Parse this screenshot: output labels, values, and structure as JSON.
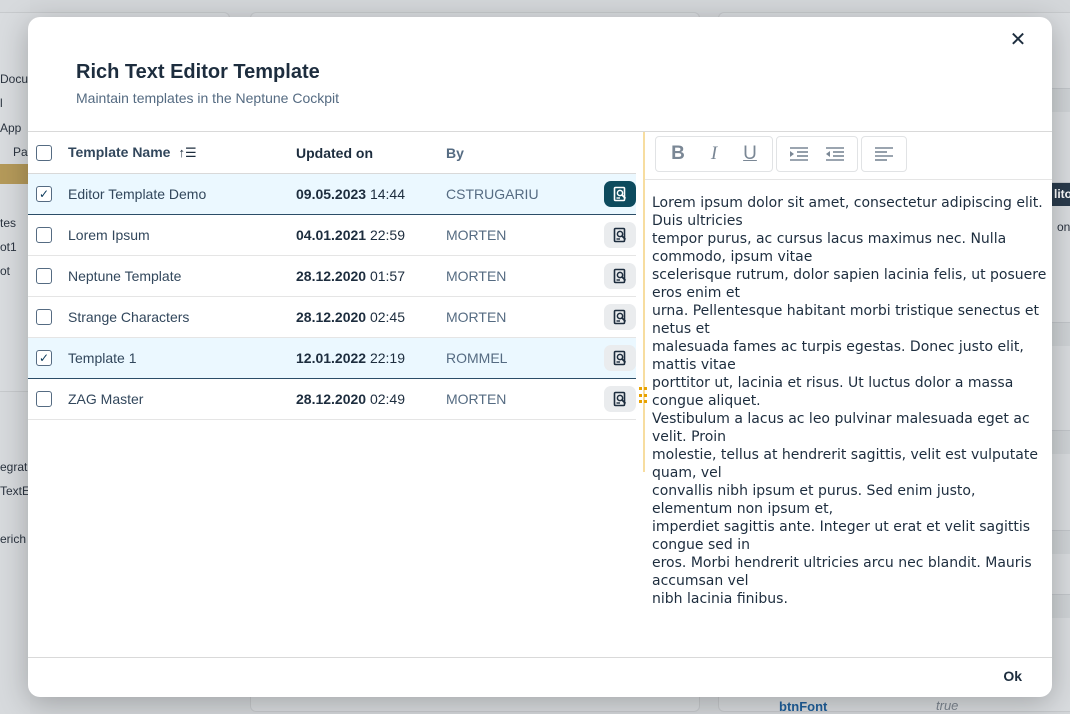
{
  "background": {
    "left_labels": [
      "Docu",
      "l",
      "App",
      "Pa",
      "tes",
      "ot1",
      "ot",
      "egrati",
      "TextE",
      "erich"
    ],
    "bottom_link": "btnFont",
    "bottom_value": "true",
    "right_label_1": "lito",
    "right_label_2": "on"
  },
  "dialog": {
    "title": "Rich Text Editor Template",
    "subtitle": "Maintain templates in the Neptune Cockpit",
    "close_icon": "close-icon",
    "ok_label": "Ok"
  },
  "table": {
    "columns": {
      "name": "Template Name",
      "updated": "Updated on",
      "by": "By"
    },
    "rows": [
      {
        "name": "Editor Template Demo",
        "date": "09.05.2023",
        "time": "14:44",
        "by": "CSTRUGARIU",
        "checked": true
      },
      {
        "name": "Lorem Ipsum",
        "date": "04.01.2021",
        "time": "22:59",
        "by": "MORTEN",
        "checked": false
      },
      {
        "name": "Neptune Template",
        "date": "28.12.2020",
        "time": "01:57",
        "by": "MORTEN",
        "checked": false
      },
      {
        "name": "Strange Characters",
        "date": "28.12.2020",
        "time": "02:45",
        "by": "MORTEN",
        "checked": false
      },
      {
        "name": "Template 1",
        "date": "12.01.2022",
        "time": "22:19",
        "by": "ROMMEL",
        "checked": true
      },
      {
        "name": "ZAG Master",
        "date": "28.12.2020",
        "time": "02:49",
        "by": "MORTEN",
        "checked": false
      }
    ]
  },
  "editor": {
    "toolbar_icons": [
      "bold-icon",
      "italic-icon",
      "underline-icon",
      "indent-icon",
      "outdent-icon",
      "align-left-icon"
    ],
    "lines": [
      "Lorem ipsum dolor sit amet, consectetur adipiscing elit. Duis ultricies",
      "tempor purus, ac cursus lacus maximus nec. Nulla commodo, ipsum vitae",
      "scelerisque rutrum, dolor sapien lacinia felis, ut posuere eros enim et",
      "urna. Pellentesque habitant morbi tristique senectus et netus et",
      "malesuada fames ac turpis egestas. Donec justo elit, mattis vitae",
      "porttitor ut, lacinia et risus. Ut luctus dolor a massa congue aliquet.",
      "Vestibulum a lacus ac leo pulvinar malesuada eget ac velit. Proin",
      "molestie, tellus at hendrerit sagittis, velit est vulputate quam, vel",
      "convallis nibh ipsum et purus. Sed enim justo, elementum non ipsum et,",
      "imperdiet sagittis ante. Integer ut erat et velit sagittis congue sed in",
      "eros. Morbi hendrerit ultricies arcu nec blandit. Mauris accumsan vel",
      "nibh lacinia finibus."
    ]
  },
  "colors": {
    "accent": "#0d4b5e",
    "selected_row": "#ebf8ff",
    "splitter": "#e8a200"
  }
}
